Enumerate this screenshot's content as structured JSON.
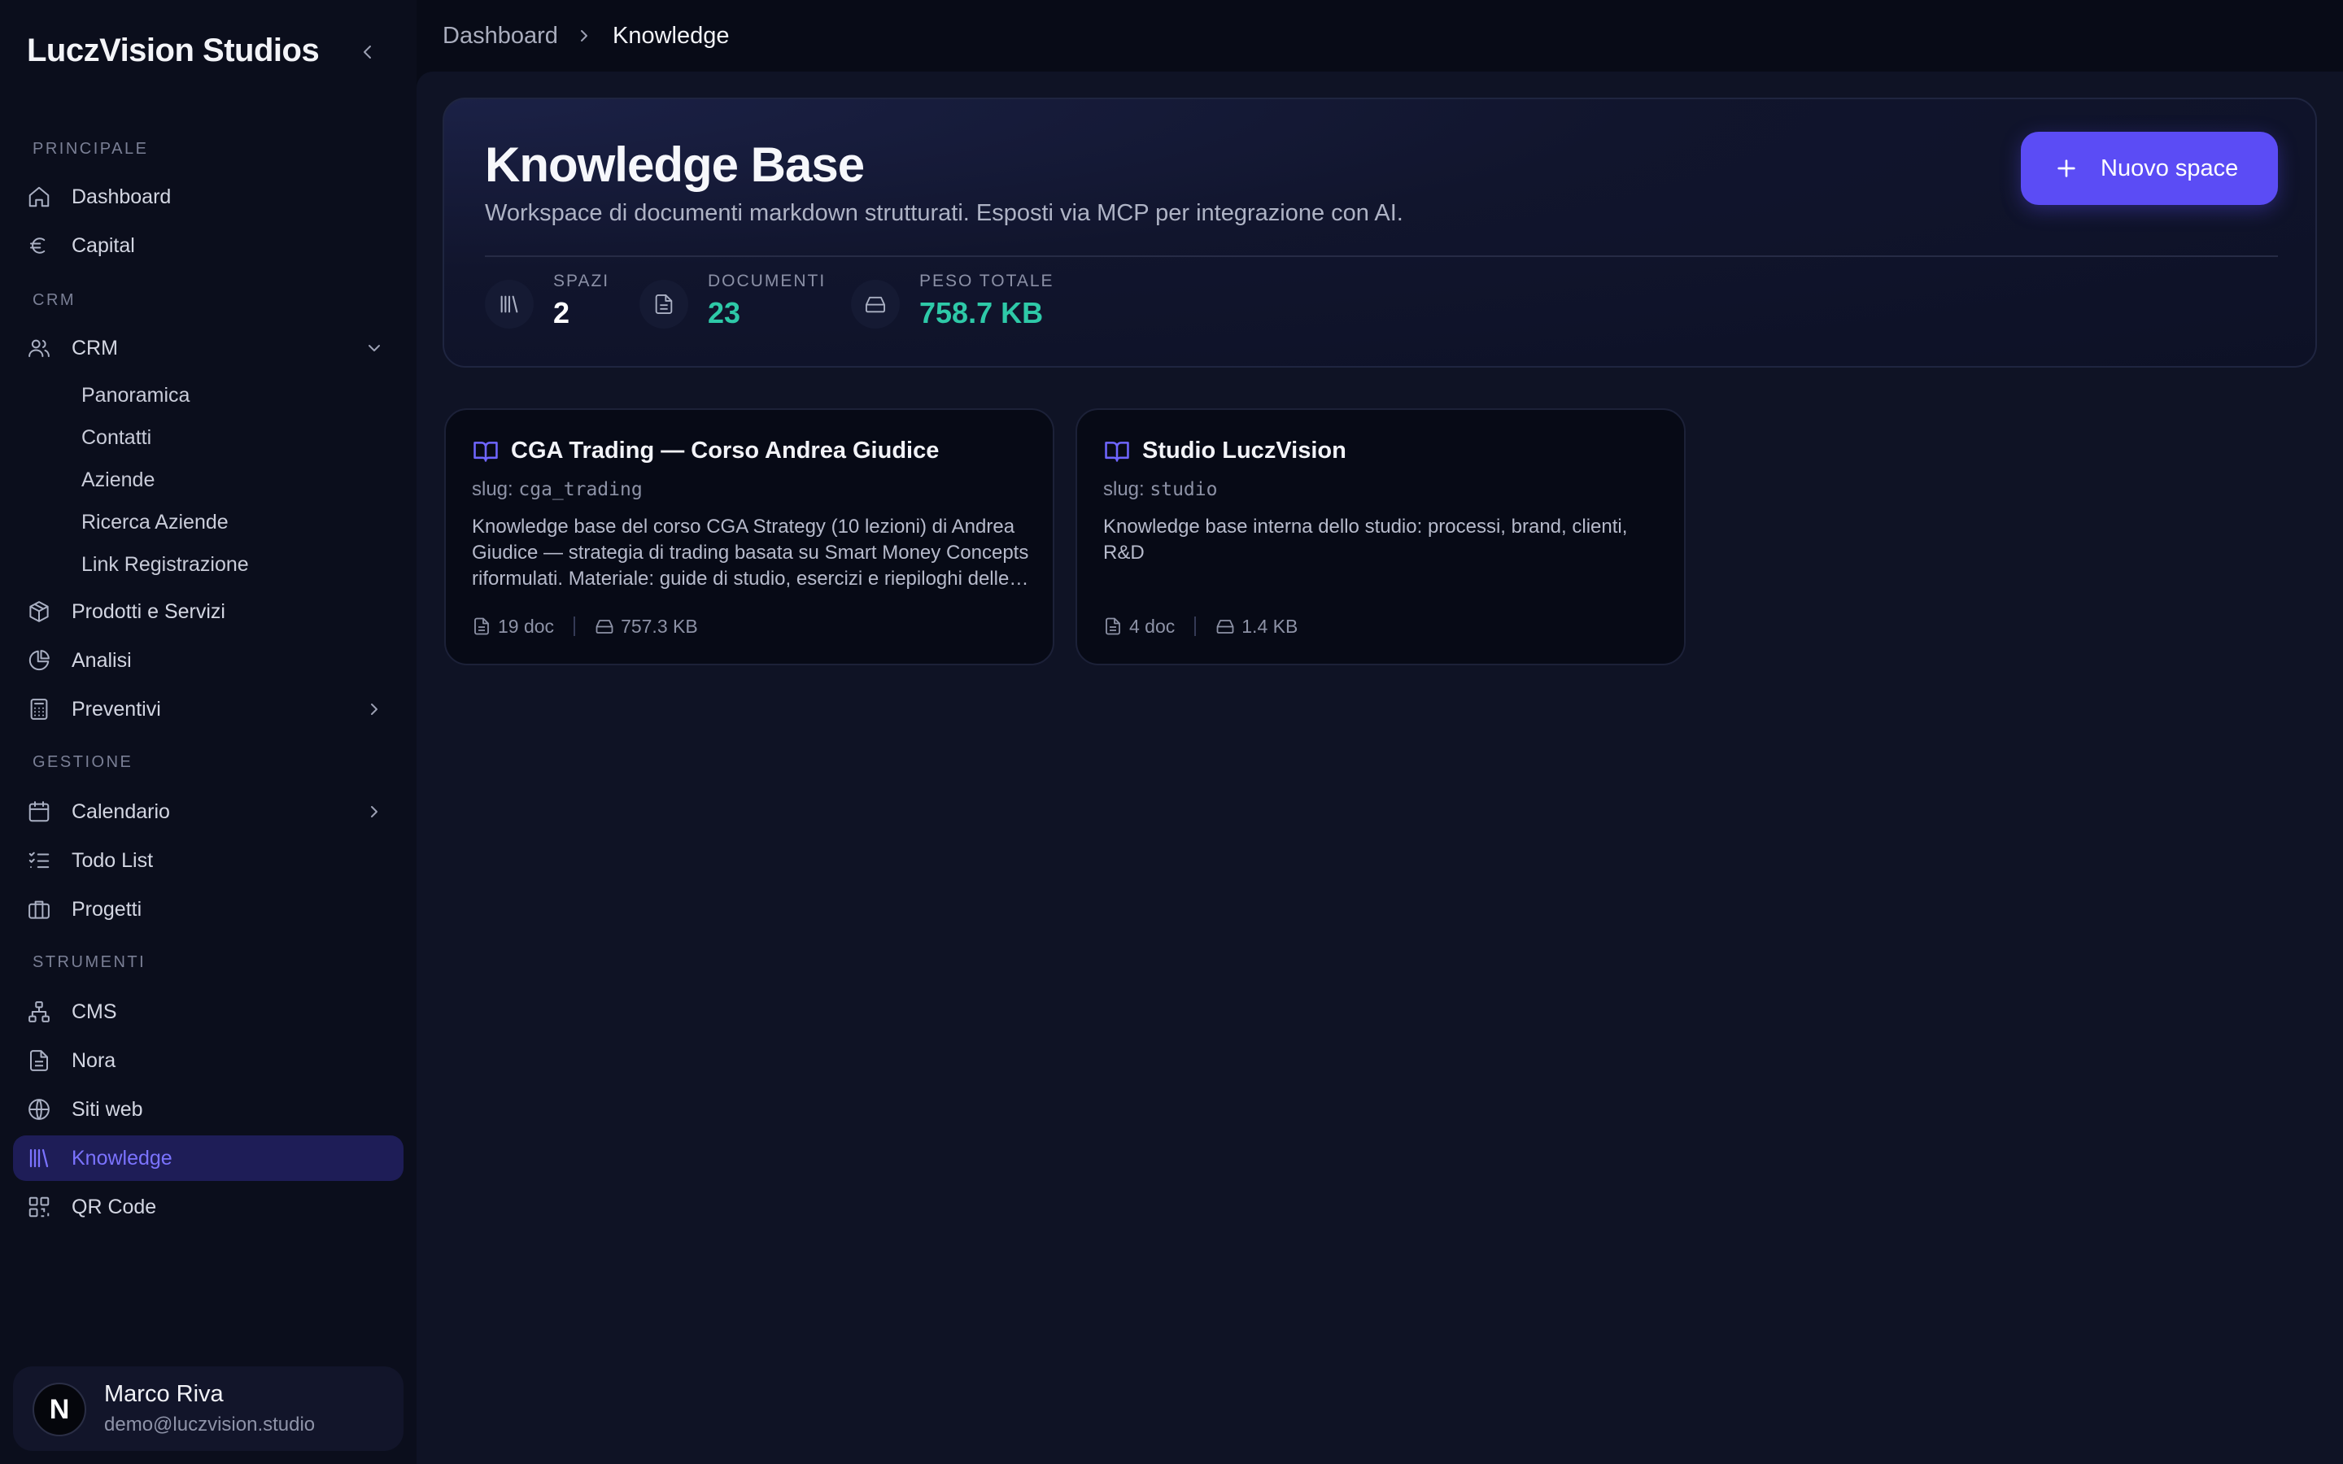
{
  "app": {
    "brand": "LuczVision Studios"
  },
  "breadcrumb": {
    "root": "Dashboard",
    "current": "Knowledge"
  },
  "sidebar": {
    "sections": {
      "principale": "PRINCIPALE",
      "crm": "CRM",
      "gestione": "GESTIONE",
      "strumenti": "STRUMENTI"
    },
    "items": {
      "dashboard": "Dashboard",
      "capital": "Capital",
      "crm": "CRM",
      "prodotti": "Prodotti e Servizi",
      "analisi": "Analisi",
      "preventivi": "Preventivi",
      "calendario": "Calendario",
      "todo": "Todo List",
      "progetti": "Progetti",
      "cms": "CMS",
      "nora": "Nora",
      "siti": "Siti web",
      "knowledge": "Knowledge",
      "qr": "QR Code"
    },
    "crm_sub": [
      "Panoramica",
      "Contatti",
      "Aziende",
      "Ricerca Aziende",
      "Link Registrazione"
    ],
    "active": "knowledge"
  },
  "user": {
    "initial": "N",
    "name": "Marco Riva",
    "email": "demo@luczvision.studio"
  },
  "hero": {
    "title": "Knowledge Base",
    "subtitle": "Workspace di documenti markdown strutturati. Esposti via MCP per integrazione con AI.",
    "new_button": "Nuovo space",
    "stats": [
      {
        "label": "SPAZI",
        "value": "2",
        "color": "#ffffff"
      },
      {
        "label": "DOCUMENTI",
        "value": "23",
        "color": "#2ec9a8"
      },
      {
        "label": "PESO TOTALE",
        "value": "758.7 KB",
        "color": "#2ec9a8"
      }
    ]
  },
  "spaces": [
    {
      "title": "CGA Trading — Corso Andrea Giudice",
      "slug_prefix": "slug:",
      "slug": "cga_trading",
      "description": "Knowledge base del corso CGA Strategy (10 lezioni) di Andrea Giudice — strategia di trading basata su Smart Money Concepts riformulati. Materiale: guide di studio, esercizi e riepiloghi delle lezioni.",
      "docs": "19 doc",
      "size": "757.3 KB"
    },
    {
      "title": "Studio LuczVision",
      "slug_prefix": "slug:",
      "slug": "studio",
      "description": "Knowledge base interna dello studio: processi, brand, clienti, R&D",
      "docs": "4 doc",
      "size": "1.4 KB"
    }
  ],
  "colors": {
    "accent": "#5b4cf5",
    "active_bg": "#1e1d57",
    "active_text": "#7b73ff",
    "teal": "#2ec9a8"
  }
}
